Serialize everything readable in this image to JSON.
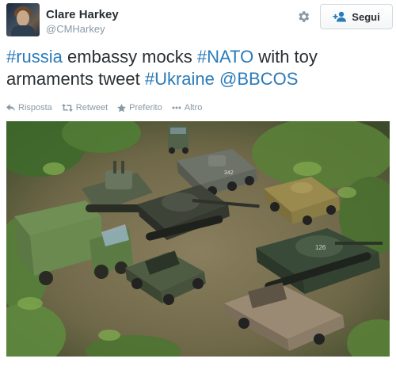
{
  "author": {
    "name": "Clare Harkey",
    "handle": "@CMHarkey"
  },
  "follow_button": {
    "label": "Segui"
  },
  "tweet": {
    "segments": [
      {
        "text": "#russia",
        "type": "hashtag"
      },
      {
        "text": " embassy mocks ",
        "type": "text"
      },
      {
        "text": "#NATO",
        "type": "hashtag"
      },
      {
        "text": " with toy armaments tweet ",
        "type": "text"
      },
      {
        "text": "#Ukraine",
        "type": "hashtag"
      },
      {
        "text": " ",
        "type": "text"
      },
      {
        "text": "@BBCOS",
        "type": "mention"
      }
    ]
  },
  "actions": {
    "reply": "Risposta",
    "retweet": "Retweet",
    "favorite": "Preferito",
    "more": "Altro"
  },
  "photo": {
    "tank_turret_numbers": [
      "342",
      "126"
    ]
  },
  "colors": {
    "link": "#2b7bb9",
    "text": "#292f33",
    "muted": "#8899a6"
  },
  "icons": {
    "gear": "gear-icon",
    "follow": "add-user-icon",
    "reply": "reply-icon",
    "retweet": "retweet-icon",
    "favorite": "star-icon",
    "more": "more-icon"
  }
}
